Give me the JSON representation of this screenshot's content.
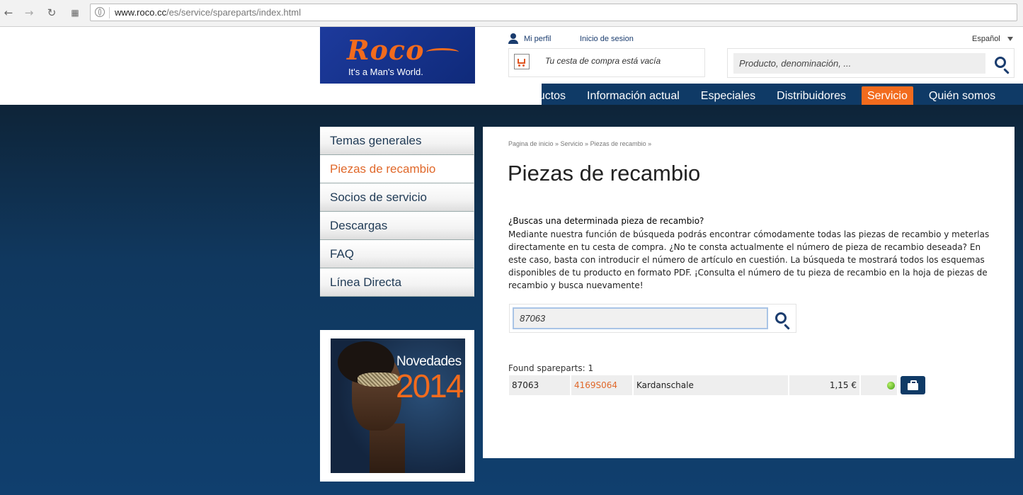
{
  "browser": {
    "url_host": "www.roco.cc",
    "url_path": "/es/service/spareparts/index.html"
  },
  "header": {
    "logo_brand": "Roco",
    "logo_tagline": "It's a Man's World.",
    "my_profile": "Mi perfil",
    "login": "Inicio de sesion",
    "language": "Español",
    "cart_text": "Tu cesta de compra está vacía",
    "search_placeholder": "Producto, denominación, ..."
  },
  "nav": {
    "items": [
      {
        "label": "Productos"
      },
      {
        "label": "Información actual"
      },
      {
        "label": "Especiales"
      },
      {
        "label": "Distribuidores"
      },
      {
        "label": "Servicio"
      },
      {
        "label": "Quién somos"
      }
    ],
    "active_index": 4,
    "accent": "#f26b1d",
    "bar_color": "#0f3a66"
  },
  "sidebar": {
    "items": [
      {
        "label": "Temas generales"
      },
      {
        "label": "Piezas de recambio"
      },
      {
        "label": "Socios de servicio"
      },
      {
        "label": "Descargas"
      },
      {
        "label": "FAQ"
      },
      {
        "label": "Línea Directa"
      }
    ],
    "active_index": 1
  },
  "promo": {
    "title": "Novedades",
    "year": "2014"
  },
  "content": {
    "breadcrumb": "Pagina de inicio » Servicio » Piezas de recambio »",
    "title": "Piezas de recambio",
    "question": "¿Buscas una determinada pieza de recambio?",
    "text": "Mediante nuestra función de búsqueda podrás encontrar cómodamente todas las piezas de recambio y meterlas directamente en tu cesta de compra. ¿No te consta actualmente el número de pieza de recambio deseada? En este caso, basta con introducir el número de artículo en cuestión. La búsqueda te mostrará todos los esquemas disponibles de tu producto en formato PDF. ¡Consulta el número de tu pieza de recambio en la hoja de piezas de recambio y busca nuevamente!",
    "search_value": "87063",
    "found_label": "Found spareparts: 1",
    "results": [
      {
        "article": "87063",
        "part": "4169S064",
        "name": "Kardanschale",
        "price": "1,15 €"
      }
    ]
  }
}
